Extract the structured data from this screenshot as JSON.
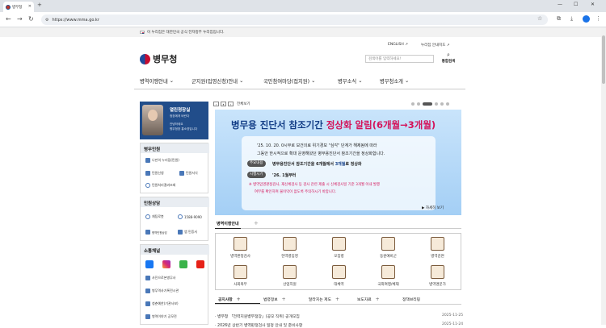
{
  "browser": {
    "tab_title": "병무청",
    "url": "https://www.mma.go.kr"
  },
  "gov_notice": "이 누리집은 대한민국 공식 전자정부 누리집입니다.",
  "header": {
    "english": "ENGLISH",
    "nuri_guide": "누리집 안내지도",
    "logo_text": "병무청",
    "search_placeholder": "검색어를 입력하세요!",
    "search_label": "통합검색"
  },
  "gnb": [
    "병역이행안내",
    "군지원(입영신청)안내",
    "국민참여마당(접지원)",
    "병무소식",
    "병무청소개"
  ],
  "profile": {
    "name": "열린청장실",
    "sub1": "청장에게 바란다",
    "sub2a": "안녕하세요",
    "sub2b": "병무청장 홍소영입니다"
  },
  "civil": {
    "title": "병무민원",
    "items": [
      "나만의 누리집(민원)",
      "민원신청",
      "민원서식",
      "민원처리결과조회"
    ]
  },
  "consult": {
    "title": "민원상담",
    "chatbot": "채팅로봇",
    "phone": "1588-9090",
    "items": [
      "병역민원상담",
      "앱 민증서"
    ]
  },
  "comm": {
    "title": "소통채널",
    "items": [
      "사진으로본병무사",
      "병무역사기록전시관",
      "청춘예찬(기관사보)",
      "병역이야기 공모전"
    ]
  },
  "banner_nav": {
    "label": "전체보기"
  },
  "banner": {
    "title_main": "병무용 진단서 참조기간 ",
    "title_hl": "정상화 알림(6개월→3개월)",
    "line1": "'25. 10. 20. 0시부로 보건의료 위기경보 \"심각\" 단계가 해제됨에 따라",
    "line2": "그동안 한시적으로 확대 운영해왔던 병무용진단서 참조기간을 정상화합니다.",
    "label1": "주요내용",
    "text1a": "병무용진단서 참조기간을 6개월에서 ",
    "text1b": "3개월",
    "text1c": "로 정상화",
    "label2": "시행시기",
    "text2": "'26. 1월부터",
    "note1": "※ 병역입영판정검사, 재신체검사 등 검사 관련 제출 시 신체검사일 기준 3개월 이내 발행",
    "note2": "여부를 확인하여 불이익이 없도록 주의하시기 바랍니다.",
    "more": "▶ 자세히 보기"
  },
  "service_tab": "병역이행안내",
  "services": [
    "병역판정검사",
    "현역병입영",
    "모집병",
    "동원예비군",
    "병역감면",
    "사회복무",
    "산업지원",
    "대체역",
    "국외여행/체재",
    "병역명문가"
  ],
  "news_tabs": [
    "공지사항",
    "법령정보",
    "달라지는 제도",
    "보도자료",
    "정책브리핑"
  ],
  "news": [
    {
      "title": "· 병무청 「전력지원병무정장」(공모 직위) 공개모집",
      "date": "2025-11-25"
    },
    {
      "title": "· 2026년 상반기 병역판정검사 일정 안내 및 준비사항",
      "date": "2025-11-24"
    }
  ],
  "colors": {
    "accent": "#214d8a",
    "highlight": "#d4145a",
    "banner_title": "#123d86"
  }
}
